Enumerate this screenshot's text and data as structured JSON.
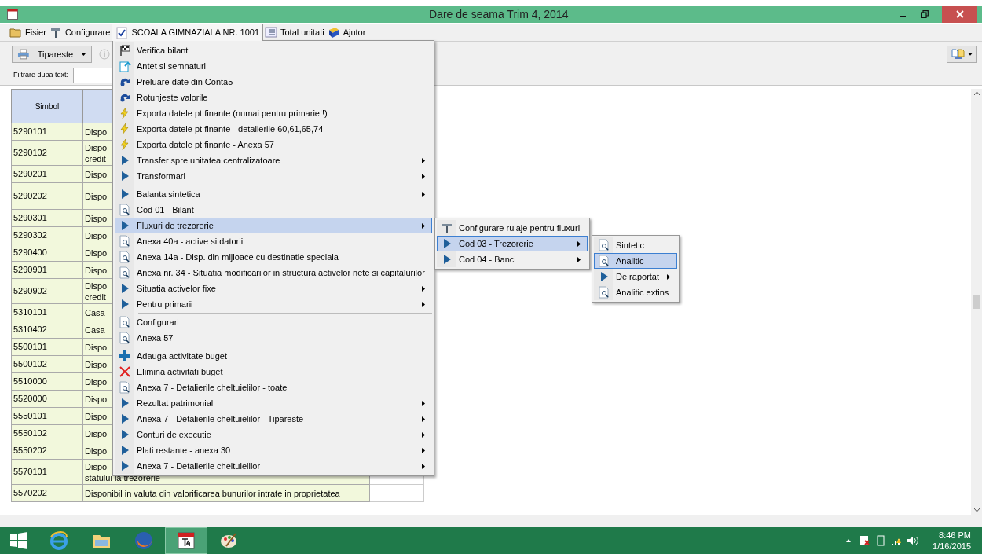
{
  "window": {
    "title": "Dare de seama Trim 4, 2014"
  },
  "menu_bar": [
    {
      "label": "Fisier",
      "kind": "folder",
      "selected": false
    },
    {
      "label": "Configurare",
      "kind": "tools",
      "selected": false
    },
    {
      "label": "SCOALA GIMNAZIALA NR. 1001",
      "kind": "check",
      "selected": true
    },
    {
      "label": "Total unitati",
      "kind": "list",
      "selected": false
    },
    {
      "label": "Ajutor",
      "kind": "help",
      "selected": false
    }
  ],
  "toolbar": {
    "print_button": "Tipareste",
    "info_disabled": true
  },
  "filter": {
    "label": "Filtrare dupa text:"
  },
  "table": {
    "columns": [
      "Simbol"
    ],
    "rows": [
      {
        "symbol": "5290101",
        "lines": [
          "Dispo"
        ]
      },
      {
        "symbol": "5290102",
        "lines": [
          "Dispo",
          "credit"
        ]
      },
      {
        "symbol": "5290201",
        "lines": [
          "Dispo"
        ]
      },
      {
        "symbol": "5290202",
        "lines": [
          "Dispo"
        ],
        "tall": true
      },
      {
        "symbol": "5290301",
        "lines": [
          "Dispo"
        ]
      },
      {
        "symbol": "5290302",
        "lines": [
          "Dispo"
        ]
      },
      {
        "symbol": "5290400",
        "lines": [
          "Dispo"
        ]
      },
      {
        "symbol": "5290901",
        "lines": [
          "Dispo"
        ]
      },
      {
        "symbol": "5290902",
        "lines": [
          "Dispo",
          "credit"
        ]
      },
      {
        "symbol": "5310101",
        "lines": [
          "Casa"
        ]
      },
      {
        "symbol": "5310402",
        "lines": [
          "Casa"
        ]
      },
      {
        "symbol": "5500101",
        "lines": [
          "Dispo"
        ]
      },
      {
        "symbol": "5500102",
        "lines": [
          "Dispo"
        ]
      },
      {
        "symbol": "5510000",
        "lines": [
          "Dispo"
        ]
      },
      {
        "symbol": "5520000",
        "lines": [
          "Dispo"
        ]
      },
      {
        "symbol": "5550101",
        "lines": [
          "Dispo"
        ]
      },
      {
        "symbol": "5550102",
        "lines": [
          "Dispo"
        ]
      },
      {
        "symbol": "5550202",
        "lines": [
          "Dispo"
        ]
      },
      {
        "symbol": "5570101",
        "lines": [
          "Dispo",
          "statului la trezorerie"
        ]
      },
      {
        "symbol": "5570202",
        "lines": [
          "Disponibil in valuta din valorificarea bunurilor intrate in proprietatea"
        ]
      }
    ]
  },
  "context_menu": [
    {
      "kind": "check",
      "label": "Verifica bilant",
      "submenu": false,
      "selected": false
    },
    {
      "kind": "header",
      "label": "Antet si semnaturi",
      "submenu": false,
      "selected": false
    },
    {
      "kind": "import",
      "label": "Preluare date din Conta5",
      "submenu": false,
      "selected": false
    },
    {
      "kind": "import",
      "label": "Rotunjeste valorile",
      "submenu": false,
      "selected": false
    },
    {
      "kind": "export",
      "label": "Exporta datele pt finante (numai pentru primarie!!)",
      "submenu": false,
      "selected": false
    },
    {
      "kind": "export",
      "label": "Exporta datele pt finante - detalierile 60,61,65,74",
      "submenu": false,
      "selected": false
    },
    {
      "kind": "export",
      "label": "Exporta datele pt finante - Anexa 57",
      "submenu": false,
      "selected": false
    },
    {
      "kind": "group",
      "label": "Transfer spre unitatea centralizatoare",
      "submenu": true,
      "selected": false
    },
    {
      "kind": "group",
      "label": "Transformari",
      "submenu": true,
      "selected": false
    },
    {
      "kind": "separator"
    },
    {
      "kind": "group",
      "label": "Balanta sintetica",
      "submenu": true,
      "selected": false
    },
    {
      "kind": "report",
      "label": "Cod 01 - Bilant",
      "submenu": false,
      "selected": false
    },
    {
      "kind": "group",
      "label": "Fluxuri de trezorerie",
      "submenu": true,
      "selected": true
    },
    {
      "kind": "report",
      "label": "Anexa 40a - active si datorii",
      "submenu": false,
      "selected": false
    },
    {
      "kind": "report",
      "label": "Anexa 14a - Disp. din mijloace cu destinatie speciala",
      "submenu": false,
      "selected": false
    },
    {
      "kind": "report",
      "label": "Anexa nr. 34 - Situatia modificarilor in structura activelor nete si capitalurilor",
      "submenu": false,
      "selected": false
    },
    {
      "kind": "group",
      "label": "Situatia activelor fixe",
      "submenu": true,
      "selected": false
    },
    {
      "kind": "group",
      "label": "Pentru primarii",
      "submenu": true,
      "selected": false
    },
    {
      "kind": "separator"
    },
    {
      "kind": "report",
      "label": "Configurari",
      "submenu": false,
      "selected": false
    },
    {
      "kind": "report",
      "label": "Anexa 57",
      "submenu": false,
      "selected": false
    },
    {
      "kind": "separator"
    },
    {
      "kind": "add",
      "label": "Adauga activitate buget",
      "submenu": false,
      "selected": false
    },
    {
      "kind": "remove",
      "label": "Elimina activitati buget",
      "submenu": false,
      "selected": false
    },
    {
      "kind": "report",
      "label": "Anexa 7 - Detalierile cheltuielilor - toate",
      "submenu": false,
      "selected": false
    },
    {
      "kind": "group",
      "label": "Rezultat patrimonial",
      "submenu": true,
      "selected": false
    },
    {
      "kind": "group",
      "label": "Anexa 7 - Detalierile cheltuielilor - Tipareste",
      "submenu": true,
      "selected": false
    },
    {
      "kind": "group",
      "label": "Conturi de executie",
      "submenu": true,
      "selected": false
    },
    {
      "kind": "group",
      "label": "Plati restante - anexa 30",
      "submenu": true,
      "selected": false
    },
    {
      "kind": "group",
      "label": "Anexa 7 - Detalierile cheltuielilor",
      "submenu": true,
      "selected": false
    }
  ],
  "submenu": [
    {
      "kind": "settings",
      "label": "Configurare rulaje pentru fluxuri",
      "submenu": false,
      "selected": false
    },
    {
      "kind": "group",
      "label": "Cod 03 - Trezorerie",
      "submenu": true,
      "selected": true
    },
    {
      "kind": "group",
      "label": "Cod 04 - Banci",
      "submenu": true,
      "selected": false
    }
  ],
  "submenu_2": [
    {
      "kind": "report",
      "label": "Sintetic",
      "submenu": false,
      "selected": false
    },
    {
      "kind": "report",
      "label": "Analitic",
      "submenu": false,
      "selected": true
    },
    {
      "kind": "group",
      "label": "De raportat",
      "submenu": true,
      "selected": false
    },
    {
      "kind": "report",
      "label": "Analitic extins",
      "submenu": false,
      "selected": false
    }
  ],
  "taskbar": {
    "apps": [
      {
        "kind": "start",
        "selected": false
      },
      {
        "kind": "browser",
        "selected": false
      },
      {
        "kind": "files",
        "selected": false
      },
      {
        "kind": "firefox",
        "selected": false
      },
      {
        "kind": "app",
        "selected": true
      },
      {
        "kind": "paint",
        "selected": false
      }
    ],
    "time": "8:46 PM",
    "date": "1/16/2015"
  }
}
